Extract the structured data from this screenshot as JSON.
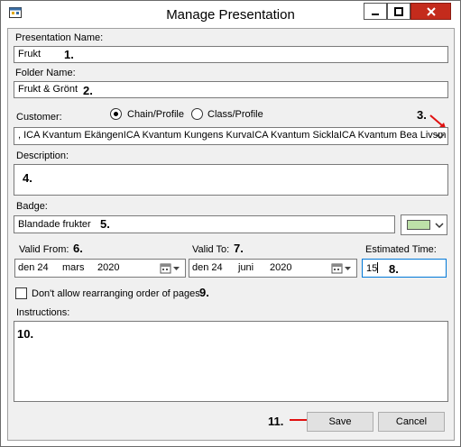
{
  "window": {
    "title": "Manage Presentation"
  },
  "presentation_name": {
    "label": "Presentation Name:",
    "value": "Frukt",
    "marker": "1."
  },
  "folder_name": {
    "label": "Folder Name:",
    "value": "Frukt & Grönt",
    "marker": "2."
  },
  "customer": {
    "label": "Customer:",
    "radio_chain": "Chain/Profile",
    "radio_class": "Class/Profile",
    "selected": "Chain/Profile",
    "value": ", ICA Kvantum EkängenICA Kvantum Kungens KurvaICA Kvantum SicklaICA Kvantum Bea Livsm",
    "marker": "3."
  },
  "description": {
    "label": "Description:",
    "value": "",
    "marker": "4."
  },
  "badge": {
    "label": "Badge:",
    "value": "Blandade frukter",
    "marker": "5.",
    "color": "#bde0a8"
  },
  "valid_from": {
    "label": "Valid From:",
    "day": "den 24",
    "month": "mars",
    "year": "2020",
    "marker": "6."
  },
  "valid_to": {
    "label": "Valid To:",
    "day": "den 24",
    "month": "juni",
    "year": "2020",
    "marker": "7."
  },
  "estimated_time": {
    "label": "Estimated Time:",
    "value": "15",
    "marker": "8."
  },
  "rearrange": {
    "label": "Don't allow rearranging order of pages",
    "checked": false,
    "marker": "9."
  },
  "instructions": {
    "label": "Instructions:",
    "value": "",
    "marker": "10."
  },
  "buttons": {
    "save": "Save",
    "cancel": "Cancel",
    "save_marker": "11."
  },
  "colors": {
    "arrow": "#e01010",
    "close_button": "#c42b1c",
    "focus_border": "#0078d7"
  }
}
